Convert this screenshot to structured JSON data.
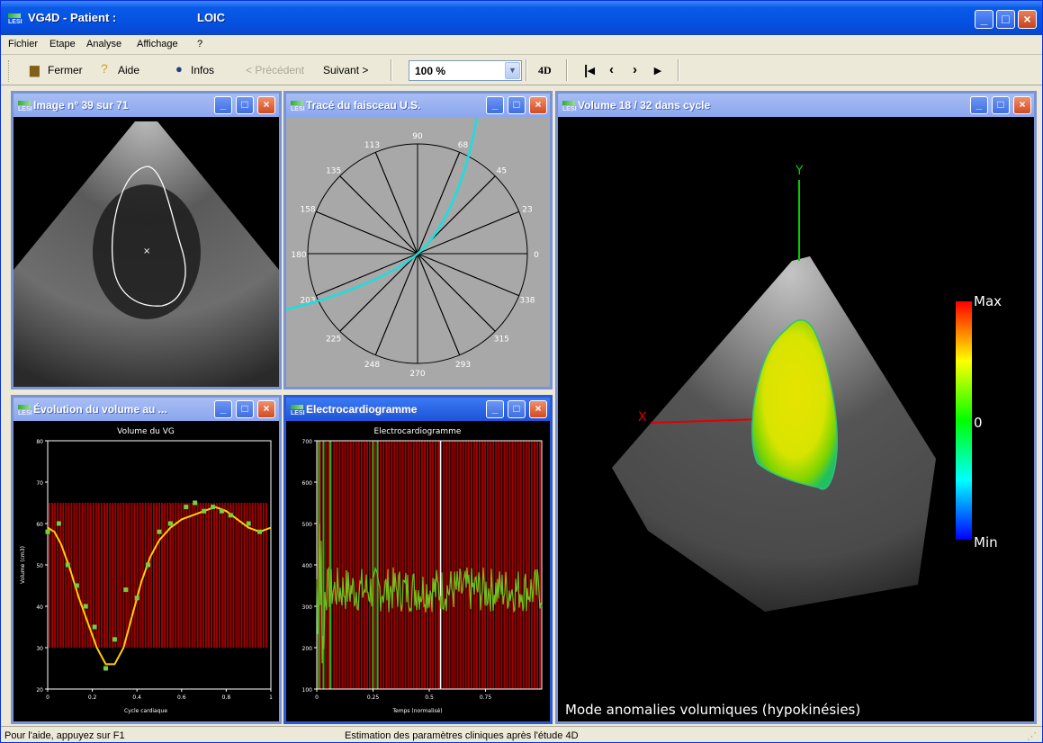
{
  "app": {
    "title": "VG4D - Patient :",
    "patient": "LOIC",
    "logo": "LESI"
  },
  "menu": {
    "items": [
      "Fichier",
      "Etape",
      "Analyse",
      "Affichage",
      "?"
    ]
  },
  "toolbar": {
    "close": "Fermer",
    "help": "Aide",
    "info": "Infos",
    "prev": "< Précédent",
    "next": "Suivant >",
    "zoom": "100 %",
    "mode4d": "4D"
  },
  "windows": {
    "image": {
      "title": "Image n° 39 sur 71"
    },
    "trace": {
      "title": "Tracé du faisceau U.S.",
      "angles": [
        "0",
        "23",
        "45",
        "68",
        "90",
        "113",
        "135",
        "158",
        "180",
        "203",
        "225",
        "248",
        "270",
        "293",
        "315",
        "338"
      ]
    },
    "volume3d": {
      "title": "Volume 18 / 32 dans cycle",
      "axis_x": "X",
      "axis_y": "Y",
      "scale_max": "Max",
      "scale_mid": "0",
      "scale_min": "Min",
      "mode": "Mode anomalies volumiques (hypokinésies)"
    },
    "evolution": {
      "title": "Évolution du volume au ..."
    },
    "ecg": {
      "title": "Electrocardiogramme"
    }
  },
  "chart_data": [
    {
      "type": "line",
      "title": "Volume du VG",
      "xlabel": "Cycle cardiaque",
      "ylabel": "Volume (cm3)",
      "xlim": [
        0,
        1
      ],
      "ylim": [
        20,
        80
      ],
      "xticks": [
        "0",
        "0.2",
        "0.4",
        "0.6",
        "0.8",
        "1"
      ],
      "yticks": [
        "20",
        "30",
        "40",
        "50",
        "60",
        "70",
        "80"
      ],
      "x": [
        0,
        0.03,
        0.06,
        0.1,
        0.14,
        0.18,
        0.22,
        0.26,
        0.3,
        0.34,
        0.38,
        0.42,
        0.46,
        0.5,
        0.55,
        0.6,
        0.65,
        0.7,
        0.75,
        0.8,
        0.85,
        0.9,
        0.95,
        1.0
      ],
      "y": [
        59,
        58,
        55,
        49,
        42,
        36,
        30,
        26,
        26,
        30,
        38,
        46,
        52,
        56,
        59,
        61,
        62,
        63,
        64,
        63,
        61,
        59,
        58,
        59
      ],
      "samples": [
        [
          0,
          58
        ],
        [
          0.05,
          60
        ],
        [
          0.09,
          50
        ],
        [
          0.13,
          45
        ],
        [
          0.17,
          40
        ],
        [
          0.21,
          35
        ],
        [
          0.26,
          25
        ],
        [
          0.3,
          32
        ],
        [
          0.35,
          44
        ],
        [
          0.4,
          42
        ],
        [
          0.45,
          50
        ],
        [
          0.5,
          58
        ],
        [
          0.55,
          60
        ],
        [
          0.62,
          64
        ],
        [
          0.66,
          65
        ],
        [
          0.7,
          63
        ],
        [
          0.74,
          64
        ],
        [
          0.78,
          63
        ],
        [
          0.82,
          62
        ],
        [
          0.9,
          60
        ],
        [
          0.95,
          58
        ]
      ]
    },
    {
      "type": "line",
      "title": "Electrocardiogramme",
      "xlabel": "Temps (normalisé)",
      "ylabel": "",
      "xlim": [
        0,
        1
      ],
      "ylim": [
        100,
        700
      ],
      "xticks": [
        "0",
        "0.25",
        "0.5",
        "0.75"
      ],
      "yticks": [
        "100",
        "200",
        "300",
        "400",
        "500",
        "600",
        "700"
      ]
    }
  ]
}
